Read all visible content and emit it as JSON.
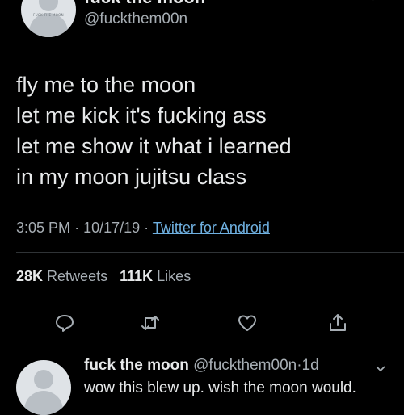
{
  "tweet": {
    "display_name": "fuck the moon",
    "handle": "@fuckthem00n",
    "avatar_caption": "FUCK THE MOON",
    "lines": [
      "fly me to the moon",
      "let me kick it's fucking ass",
      "let me show it what i learned",
      "in my moon jujitsu class"
    ],
    "time": "3:05 PM",
    "date": "10/17/19",
    "separator": "·",
    "source": "Twitter for Android",
    "retweets_count": "28K",
    "retweets_label": "Retweets",
    "likes_count": "111K",
    "likes_label": "Likes"
  },
  "actions": {
    "icons": [
      "reply-icon",
      "retweet-icon",
      "like-icon",
      "share-icon"
    ]
  },
  "reply": {
    "display_name": "fuck the moon",
    "handle": "@fuckthem00n",
    "separator": "·",
    "time": "1d",
    "text": "wow this blew up. wish the moon would."
  },
  "colors": {
    "background": "#000000",
    "text": "#e7e9ea",
    "secondary": "#a6adb3",
    "link": "#6fb0e0",
    "divider": "#2f3336"
  }
}
